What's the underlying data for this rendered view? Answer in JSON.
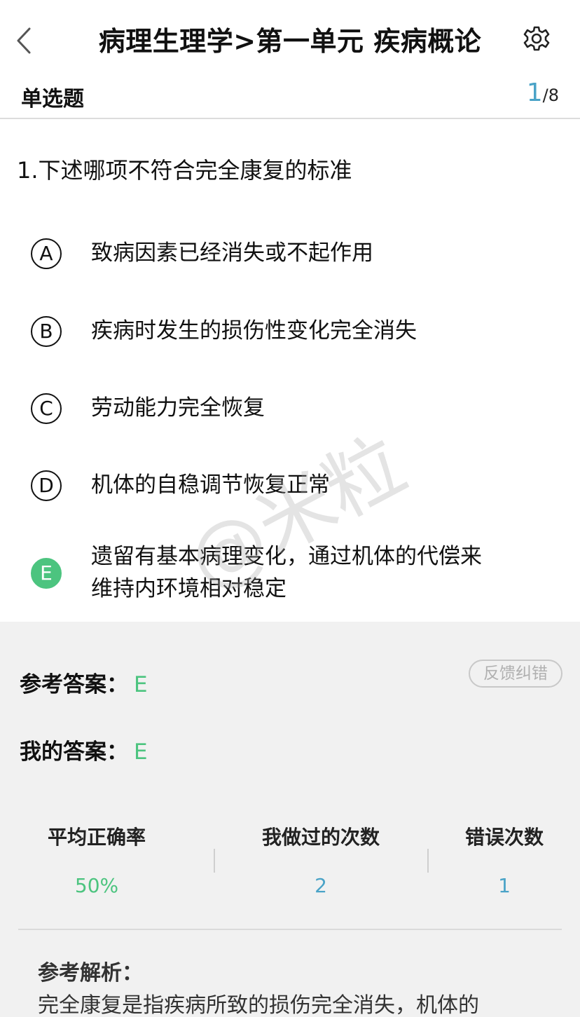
{
  "header": {
    "title": "病理生理学>第一单元 疾病概论",
    "back_icon": "chevron-left-icon",
    "settings_icon": "gear-icon"
  },
  "question_meta": {
    "type_label": "单选题",
    "current": "1",
    "total": "/8"
  },
  "question": {
    "text": "1.下述哪项不符合完全康复的标准",
    "options": [
      {
        "letter": "A",
        "line1": "致病因素已经消失或不起作用",
        "line2": ""
      },
      {
        "letter": "B",
        "line1": "疾病时发生的损伤性变化完全消失",
        "line2": ""
      },
      {
        "letter": "C",
        "line1": "劳动能力完全恢复",
        "line2": ""
      },
      {
        "letter": "D",
        "line1": "机体的自稳调节恢复正常",
        "line2": ""
      },
      {
        "letter": "E",
        "line1": "遗留有基本病理变化，通过机体的代偿来",
        "line2": "维持内环境相对稳定"
      }
    ]
  },
  "answer": {
    "reference_label": "参考答案：",
    "reference_value": "E",
    "mine_label": "我的答案：",
    "mine_value": "E",
    "feedback_button": "反馈纠错"
  },
  "stats": {
    "avg_label": "平均正确率",
    "avg_value": "50%",
    "times_label": "我做过的次数",
    "times_value": "2",
    "errors_label": "错误次数",
    "errors_value": "1"
  },
  "analysis": {
    "title": "参考解析：",
    "text": "完全康复是指疾病所致的损伤完全消失，机体的"
  },
  "watermark": "@米粒",
  "colors": {
    "correct_green": "#4cc47f",
    "accent_blue": "#4aa3c7",
    "panel_bg": "#f1f1f1"
  }
}
